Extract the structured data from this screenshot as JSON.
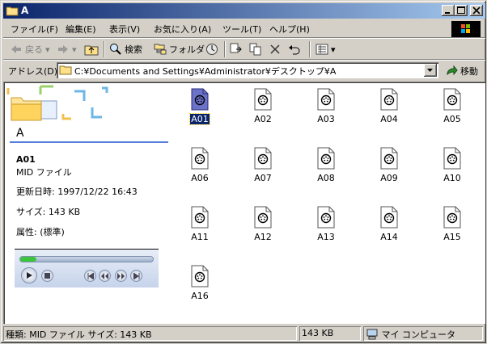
{
  "window": {
    "title": "A"
  },
  "menu": [
    "ファイル(F)",
    "編集(E)",
    "表示(V)",
    "お気に入り(A)",
    "ツール(T)",
    "ヘルプ(H)"
  ],
  "toolbar": {
    "back": "戻る",
    "search": "検索",
    "folders": "フォルダ"
  },
  "address": {
    "label": "アドレス(D)",
    "path": "C:¥Documents and Settings¥Administrator¥デスクトップ¥A",
    "go": "移動"
  },
  "leftpane": {
    "folder_name": "A",
    "file_name": "A01",
    "file_type": "MID ファイル",
    "modified": "更新日時: 1997/12/22 16:43",
    "size": "サイズ: 143 KB",
    "attributes": "属性: (標準)",
    "player_progress": 0.12
  },
  "files": [
    {
      "name": "A01",
      "selected": true
    },
    {
      "name": "A02"
    },
    {
      "name": "A03"
    },
    {
      "name": "A04"
    },
    {
      "name": "A05"
    },
    {
      "name": "A06"
    },
    {
      "name": "A07"
    },
    {
      "name": "A08"
    },
    {
      "name": "A09"
    },
    {
      "name": "A10"
    },
    {
      "name": "A11"
    },
    {
      "name": "A12"
    },
    {
      "name": "A13"
    },
    {
      "name": "A14"
    },
    {
      "name": "A15"
    },
    {
      "name": "A16"
    }
  ],
  "status": {
    "info": "種類: MID ファイル サイズ: 143 KB",
    "size": "143 KB",
    "zone": "マイ コンピュータ"
  },
  "colors": {
    "titlebar_start": "#0a246a",
    "titlebar_end": "#a6caf0",
    "selection": "#0a246a"
  }
}
